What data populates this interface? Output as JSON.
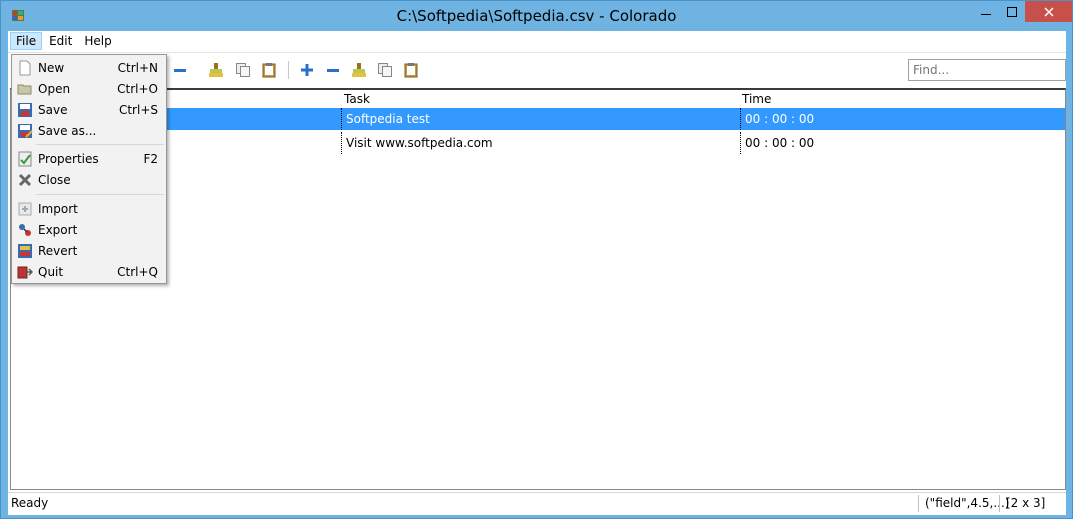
{
  "window": {
    "title": "C:\\Softpedia\\Softpedia.csv - Colorado"
  },
  "menubar": {
    "file": "File",
    "edit": "Edit",
    "help": "Help"
  },
  "search": {
    "placeholder": "Find..."
  },
  "table": {
    "columns": [
      "",
      "Task",
      "Time"
    ],
    "rows": [
      {
        "col0": "",
        "task": "Softpedia test",
        "time": "00 : 00 : 00",
        "selected": true
      },
      {
        "col0": "",
        "task": "Visit www.softpedia.com",
        "time": "00 : 00 : 00",
        "selected": false
      }
    ]
  },
  "file_menu": {
    "items": [
      {
        "label": "New",
        "shortcut": "Ctrl+N",
        "icon": "new-file-icon"
      },
      {
        "label": "Open",
        "shortcut": "Ctrl+O",
        "icon": "folder-icon"
      },
      {
        "label": "Save",
        "shortcut": "Ctrl+S",
        "icon": "save-icon"
      },
      {
        "label": "Save as...",
        "shortcut": "",
        "icon": "save-as-icon"
      },
      {
        "label": "Properties",
        "shortcut": "F2",
        "icon": "properties-icon"
      },
      {
        "label": "Close",
        "shortcut": "",
        "icon": "close-x-icon"
      },
      {
        "label": "Import",
        "shortcut": "",
        "icon": "import-icon"
      },
      {
        "label": "Export",
        "shortcut": "",
        "icon": "export-icon"
      },
      {
        "label": "Revert",
        "shortcut": "",
        "icon": "revert-icon"
      },
      {
        "label": "Quit",
        "shortcut": "Ctrl+Q",
        "icon": "quit-icon"
      }
    ]
  },
  "status": {
    "text": "Ready",
    "format": "(\"field\",4.5,...)",
    "size": "[2 x 3]"
  },
  "colors": {
    "selection": "#3399ff",
    "titlebar": "#6fb3e3",
    "close_button": "#c7504a"
  }
}
